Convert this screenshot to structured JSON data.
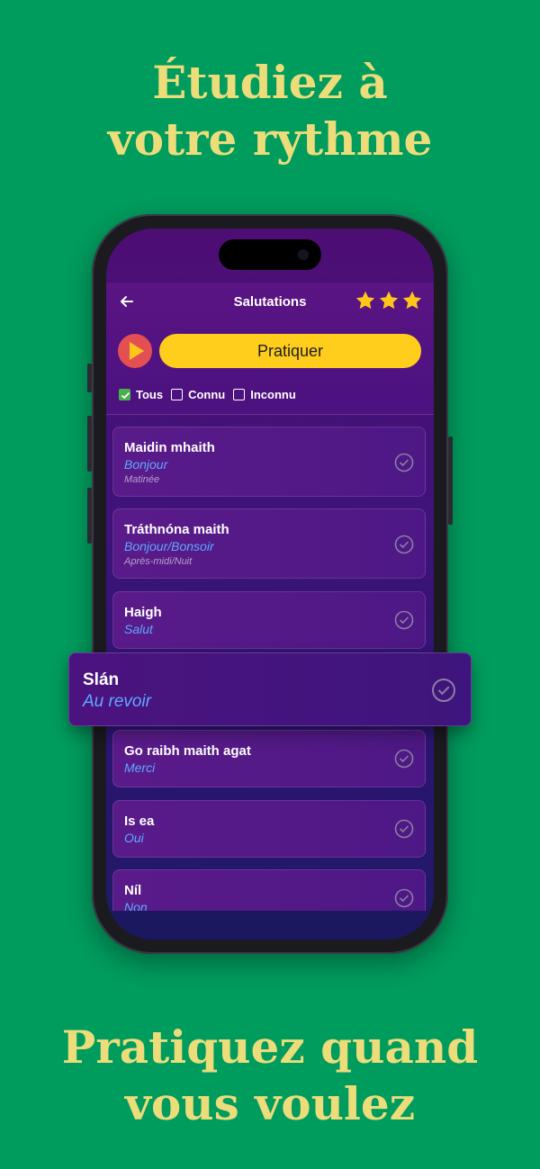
{
  "headline_top": {
    "line1": "Étudiez à",
    "line2": "votre rythme"
  },
  "headline_bottom": {
    "line1": "Pratiquez quand",
    "line2": "vous voulez"
  },
  "app": {
    "title": "Salutations",
    "stars_count": 3,
    "practice_label": "Pratiquer",
    "filters": [
      {
        "label": "Tous",
        "checked": true
      },
      {
        "label": "Connu",
        "checked": false
      },
      {
        "label": "Inconnu",
        "checked": false
      }
    ]
  },
  "phrases": [
    {
      "irish": "Maidin mhaith",
      "french": "Bonjour",
      "hint": "Matinée"
    },
    {
      "irish": "Tráthnóna maith",
      "french": "Bonjour/Bonsoir",
      "hint": "Après-midi/Nuit"
    },
    {
      "irish": "Haigh",
      "french": "Salut"
    },
    {
      "irish": "Go raibh maith agat",
      "french": "Merci"
    },
    {
      "irish": "Is ea",
      "french": "Oui"
    },
    {
      "irish": "Níl",
      "french": "Non"
    }
  ],
  "highlighted_phrase": {
    "irish": "Slán",
    "french": "Au revoir"
  },
  "colors": {
    "background": "#009c5e",
    "headline": "#ecdc7a",
    "practice_button": "#ffcd1c",
    "play_button": "#e34f52",
    "translation_text": "#5ea8ff"
  },
  "icons": {
    "back": "arrow-left-icon",
    "star": "star-icon",
    "play": "play-icon",
    "check": "check-circle-icon"
  }
}
